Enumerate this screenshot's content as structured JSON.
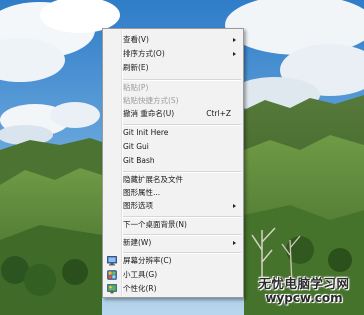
{
  "context_menu": {
    "view": "查看(V)",
    "sort_by": "排序方式(O)",
    "refresh": "刷新(E)",
    "paste": "粘贴(P)",
    "paste_shortcut": "粘贴快捷方式(S)",
    "undo_rename": "撤消 重命名(U)",
    "undo_rename_shortcut": "Ctrl+Z",
    "git_init": "Git Init Here",
    "git_gui": "Git Gui",
    "git_bash": "Git Bash",
    "hide_extensions": "隐藏扩展名及文件",
    "graphics_properties": "图形属性...",
    "graphics_options": "图形选项",
    "next_background": "下一个桌面背景(N)",
    "new": "新建(W)",
    "screen_resolution": "屏幕分辨率(C)",
    "gadgets": "小工具(G)",
    "personalize": "个性化(R)"
  },
  "watermark": {
    "line1": "无忧电脑学习网",
    "line2": "wypcw.com"
  },
  "icons": {
    "screen_resolution": "monitor-icon",
    "gadgets": "gadgets-icon",
    "personalize": "personalize-icon"
  },
  "colors": {
    "menu_background": "#f2f2f2",
    "disabled_text": "#9b9b9b",
    "sky": "#4a8fd0",
    "mountains": "#3a6b2c"
  }
}
